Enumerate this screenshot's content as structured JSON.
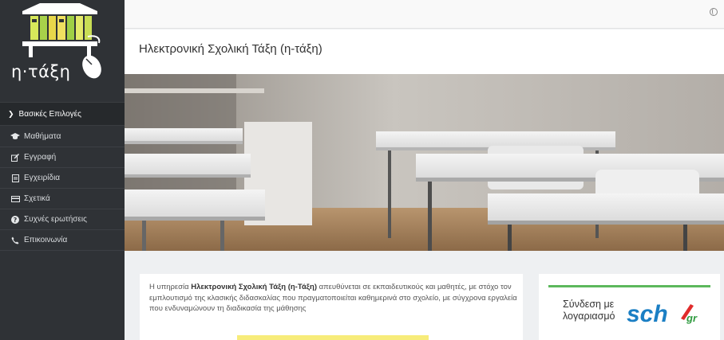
{
  "brand": {
    "logo_text": "η·τάξη"
  },
  "sidebar": {
    "section_label": "Βασικές Επιλογές",
    "items": [
      {
        "label": "Μαθήματα",
        "icon": "graduation-cap-icon"
      },
      {
        "label": "Εγγραφή",
        "icon": "edit-icon"
      },
      {
        "label": "Εγχειρίδια",
        "icon": "document-icon"
      },
      {
        "label": "Σχετικά",
        "icon": "credit-card-icon"
      },
      {
        "label": "Συχνές ερωτήσεις",
        "icon": "question-circle-icon"
      },
      {
        "label": "Επικοινωνία",
        "icon": "phone-icon"
      }
    ]
  },
  "topbar": {
    "language_icon": "globe-icon"
  },
  "page": {
    "title": "Ηλεκτρονική Σχολική Τάξη (η-τάξη)"
  },
  "intro": {
    "prefix": "Η υπηρεσία ",
    "service_name": "Ηλεκτρονική Σχολική Τάξη (η-Τάξη)",
    "suffix": " απευθύνεται σε εκπαιδευτικούς και μαθητές, με στόχο τον εμπλουτισμό της κλασικής διδασκαλίας που πραγματοποιείται καθημερινά στο σχολείο, με σύγχρονα εργαλεία που ενδυναμώνουν τη διαδικασία της μάθησης"
  },
  "login": {
    "line1": "Σύνδεση με",
    "line2": "λογαριασμό",
    "provider": "sch",
    "provider_tld": "gr"
  },
  "colors": {
    "sidebar_bg": "#2f3236",
    "accent_green": "#5cb85c",
    "sch_blue": "#1b7fc4",
    "sch_red": "#e02b2b"
  }
}
